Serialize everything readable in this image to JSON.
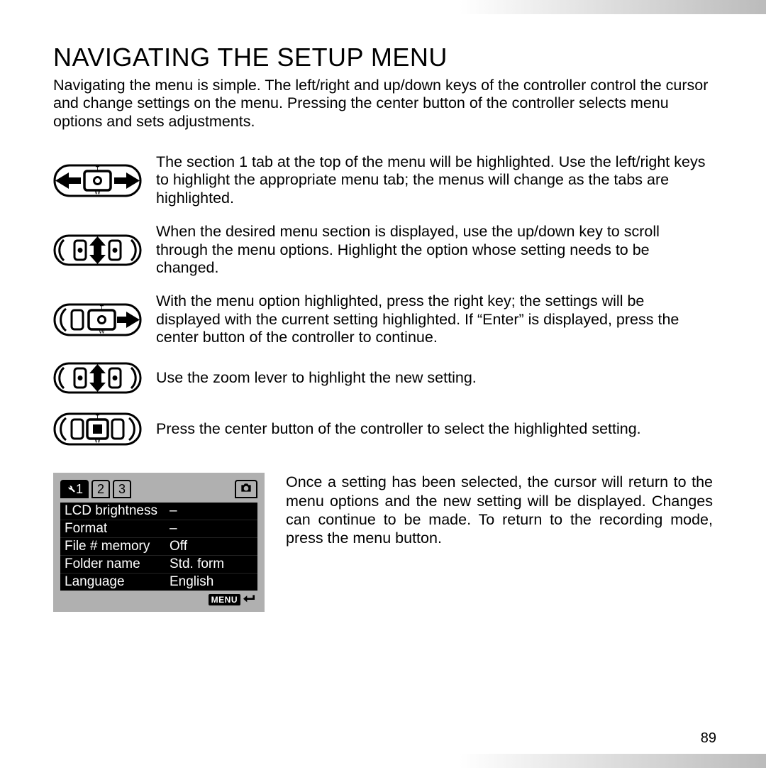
{
  "title": "NAVIGATING THE SETUP MENU",
  "intro": "Navigating the menu is simple. The left/right and up/down keys of the controller control the cursor and change settings on the menu. Pressing the center button of the controller selects menu options and sets adjustments.",
  "steps": [
    {
      "icon": "dpad-left-right",
      "text": "The section 1 tab at the top of the menu will be highlighted. Use the left/right keys to highlight the appropriate menu tab; the menus will change as the tabs are highlighted."
    },
    {
      "icon": "dpad-up-down",
      "text": "When the desired menu section is displayed, use the up/down key to scroll through the menu options. Highlight the option whose setting needs to be changed."
    },
    {
      "icon": "dpad-right",
      "text": "With the menu option highlighted, press the right key; the settings will be displayed with the current setting highlighted. If “Enter” is displayed, press the center button of the controller to continue."
    },
    {
      "icon": "dpad-up-down",
      "text": "Use the zoom lever to highlight the new setting."
    },
    {
      "icon": "dpad-center",
      "text": "Press the center button of the controller to select the highlighted setting."
    }
  ],
  "lcd": {
    "tabs": [
      "1",
      "2",
      "3"
    ],
    "active_tab_label": "1",
    "active_tab_prefix_icon": "wrench",
    "right_tab_icon": "camera",
    "rows": [
      {
        "label": "LCD brightness",
        "value": "–"
      },
      {
        "label": "Format",
        "value": "–"
      },
      {
        "label": "File # memory",
        "value": "Off"
      },
      {
        "label": "Folder name",
        "value": "Std. form"
      },
      {
        "label": "Language",
        "value": "English"
      }
    ],
    "footer_label": "MENU",
    "footer_icon": "return"
  },
  "final_text": "Once a setting has been selected, the cursor will return to the menu options and the new setting will be displayed. Changes can continue to be made. To return to the recording mode, press the menu button.",
  "page_number": "89"
}
